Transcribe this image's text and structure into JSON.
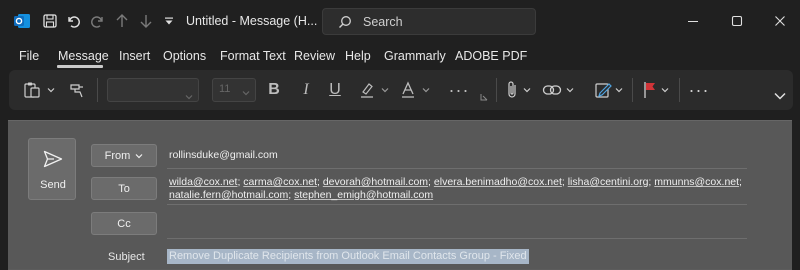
{
  "window": {
    "title": "Untitled  -  Message (H...",
    "search_placeholder": "Search"
  },
  "menu": {
    "items": [
      "File",
      "Message",
      "Insert",
      "Options",
      "Format Text",
      "Review",
      "Help",
      "Grammarly",
      "ADOBE PDF"
    ],
    "active": "Message"
  },
  "ribbon": {
    "font_size": "11",
    "bold": "B",
    "italic": "I",
    "underline": "U",
    "more": "···"
  },
  "compose": {
    "send_label": "Send",
    "from_label": "From",
    "to_label": "To",
    "cc_label": "Cc",
    "subject_label": "Subject",
    "from_value": "rollinsduke@gmail.com",
    "to_line1": [
      "wilda@cox.net",
      "carma@cox.net",
      "devorah@hotmail.com",
      "elvera.benimadho@cox.net",
      "lisha@centini.org",
      "mmunns@cox.net"
    ],
    "to_line2": [
      "natalie.fern@hotmail.com",
      "stephen_emigh@hotmail.com"
    ],
    "subject_value": "Remove Duplicate Recipients from Outlook Email Contacts Group - Fixed"
  },
  "colors": {
    "flag": "#d13438",
    "accent_outlook": "#0f78d4",
    "selection": "#a7b6c7"
  }
}
